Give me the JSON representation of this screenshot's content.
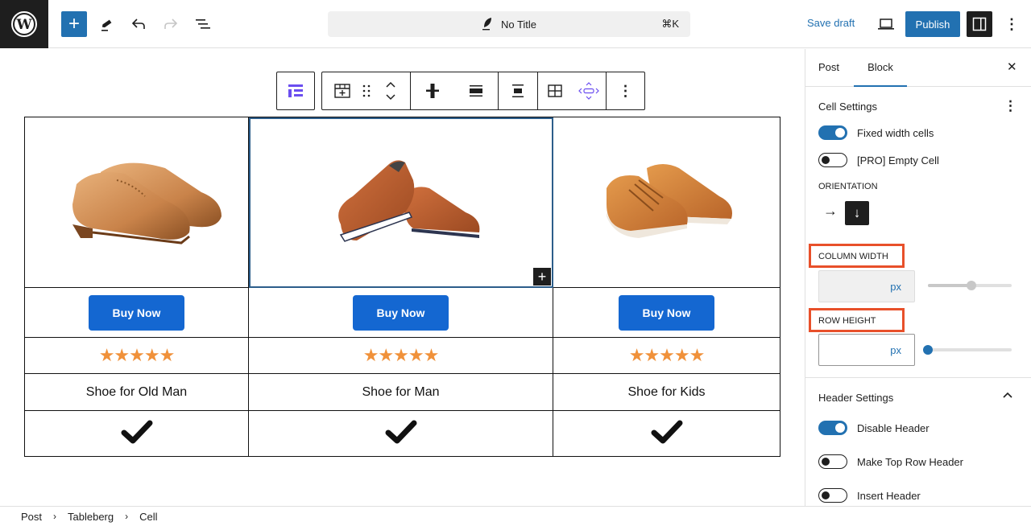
{
  "topbar": {
    "logo": "wordpress-logo",
    "add_block": "+",
    "tools": [
      "pencil-icon",
      "undo-icon",
      "redo-icon",
      "list-view-icon"
    ],
    "command_bar": {
      "title": "No Title",
      "shortcut": "⌘K"
    },
    "save_draft": "Save draft",
    "publish": "Publish",
    "options": "⋮"
  },
  "block_toolbar": {
    "more": "⋮"
  },
  "table": {
    "columns": [
      {
        "image": "brown brogue wingtip shoes",
        "button": "Buy Now",
        "rating": 5,
        "stars": "★★★★★",
        "name": "Shoe for Old Man",
        "check": "✔"
      },
      {
        "image": "brown leather sneakers",
        "button": "Buy Now",
        "rating": 5,
        "stars": "★★★★★",
        "name": "Shoe for Man",
        "check": "✔"
      },
      {
        "image": "tan leather sneakers",
        "button": "Buy Now",
        "rating": 5,
        "stars": "★★★★★",
        "name": "Shoe for Kids",
        "check": "✔"
      }
    ],
    "cell_add": "+"
  },
  "sidebar": {
    "tabs": [
      {
        "label": "Post",
        "active": false
      },
      {
        "label": "Block",
        "active": true
      }
    ],
    "close": "✕",
    "cell_settings": {
      "title": "Cell Settings",
      "more": "⋮",
      "toggles": [
        {
          "label": "Fixed width cells",
          "on": true
        },
        {
          "label": "[PRO] Empty Cell",
          "on": false
        }
      ],
      "orientation_label": "ORIENTATION",
      "orientation_options": [
        "→",
        "↓"
      ],
      "orientation_selected": "↓",
      "column_width": {
        "label": "COLUMN WIDTH",
        "value": "",
        "unit": "px",
        "slider_percent": 52
      },
      "row_height": {
        "label": "ROW HEIGHT",
        "value": "",
        "unit": "px",
        "slider_percent": 0
      }
    },
    "header_settings": {
      "title": "Header Settings",
      "chevron": "⌃",
      "toggles": [
        {
          "label": "Disable Header",
          "on": true
        },
        {
          "label": "Make Top Row Header",
          "on": false
        },
        {
          "label": "Insert Header",
          "on": false
        }
      ]
    }
  },
  "breadcrumb": [
    "Post",
    "Tableberg",
    "Cell"
  ],
  "colors": {
    "accent": "#2271b1",
    "buy_button": "#1467d1",
    "stars": "#f0913a",
    "highlight": "#e8502a"
  }
}
